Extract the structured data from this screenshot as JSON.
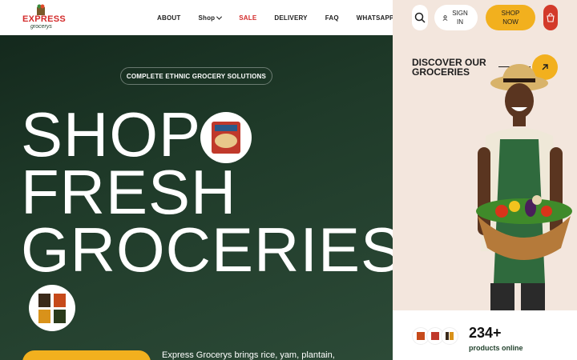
{
  "brand": {
    "name": "EXPRESS",
    "sub": "grocerys"
  },
  "nav": [
    {
      "label": "ABOUT"
    },
    {
      "label": "Shop"
    },
    {
      "label": "SALE"
    },
    {
      "label": "DELIVERY"
    },
    {
      "label": "FAQ"
    },
    {
      "label": "WHATSAPP"
    }
  ],
  "header_actions": {
    "signin_label": "SIGN IN",
    "shopnow_label": "SHOP NOW"
  },
  "hero": {
    "tagline": "COMPLETE ETHNIC GROCERY SOLUTIONS",
    "headline": [
      "SHOP",
      "FRESH",
      "GROCERIES"
    ],
    "description": "Express Grocerys brings rice, yam, plantain,"
  },
  "side": {
    "discover": "DISCOVER OUR GROCERIES",
    "product_count": "234+",
    "product_label": "products online"
  },
  "colors": {
    "accent": "#f2b01e",
    "brand_red": "#d32a2a",
    "hero_green": "#1f3a29",
    "side_bg": "#f3e6dd"
  },
  "icons": [
    "search-icon",
    "user-icon",
    "cart-icon",
    "arrow-up-right-icon",
    "chevron-down-icon"
  ]
}
